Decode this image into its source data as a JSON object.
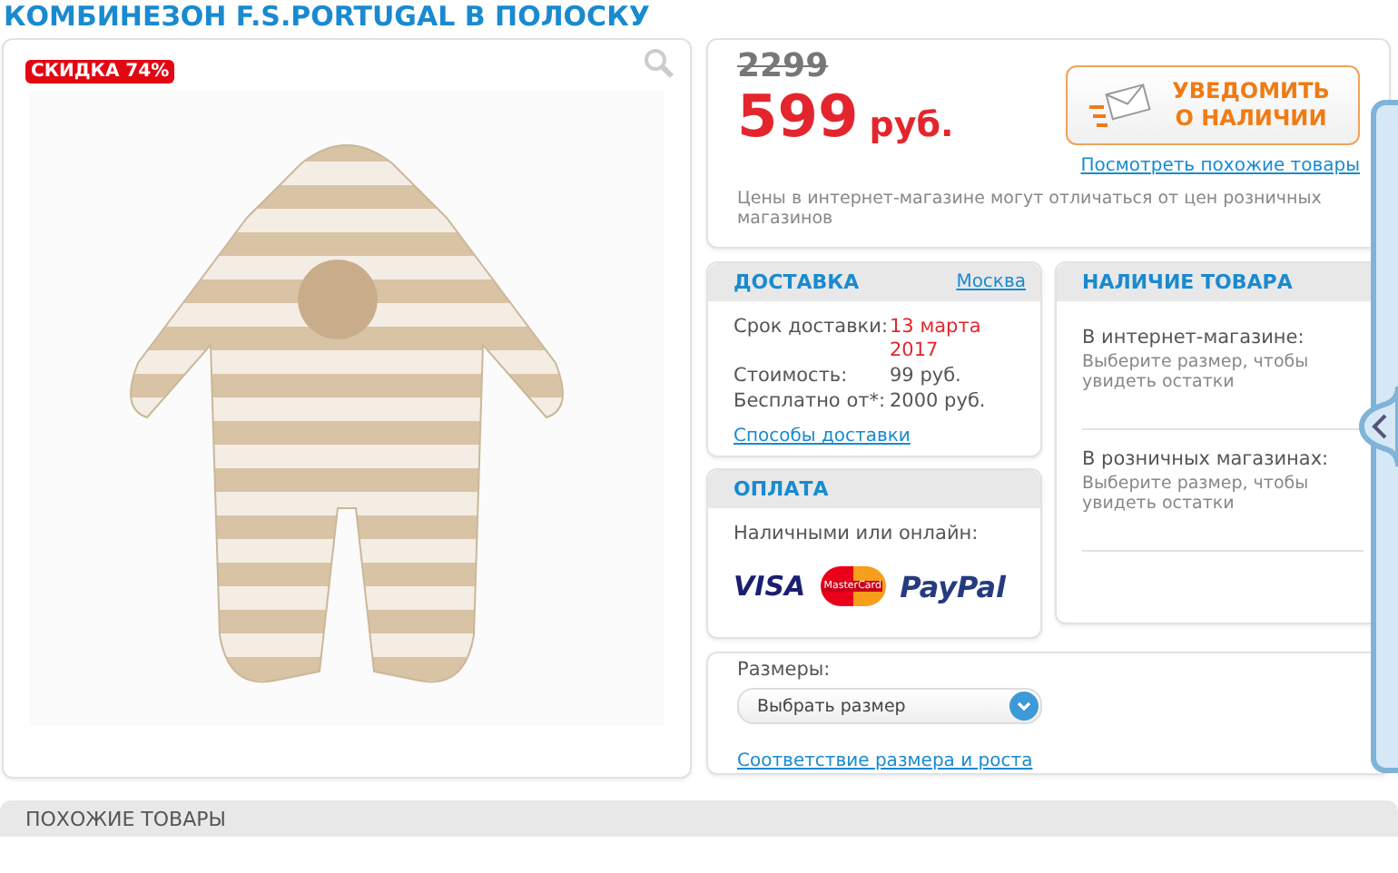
{
  "title": "КОМБИНЕЗОН F.S.PORTUGAL В ПОЛОСКУ",
  "product": {
    "discount_badge": "СКИДКА 74%"
  },
  "price": {
    "old": "2299",
    "current": "599",
    "currency": "руб.",
    "notify_button": "УВЕДОМИТЬ О НАЛИЧИИ",
    "similar_link": "Посмотреть похожие товары",
    "note": "Цены в интернет-магазине могут отличаться от цен розничных магазинов"
  },
  "delivery": {
    "heading": "ДОСТАВКА",
    "city_link": "Москва",
    "rows": [
      {
        "label": "Срок доставки:",
        "value": "13 марта 2017",
        "highlight": true
      },
      {
        "label": "Стоимость:",
        "value": "99 руб.",
        "highlight": false
      },
      {
        "label": "Бесплатно от*:",
        "value": "2000 руб.",
        "highlight": false
      }
    ],
    "methods_link": "Способы доставки"
  },
  "payment": {
    "heading": "ОПЛАТА",
    "label": "Наличными или онлайн:",
    "methods": [
      {
        "kind": "visa",
        "text": "VISA"
      },
      {
        "kind": "mastercard",
        "text": "MasterCard"
      },
      {
        "kind": "paypal",
        "text": "PayPal"
      }
    ]
  },
  "availability": {
    "heading": "НАЛИЧИЕ ТОВАРА",
    "sections": [
      {
        "title": "В интернет-магазине:",
        "hint": "Выберите размер, чтобы увидеть остатки"
      },
      {
        "title": "В розничных магазинах:",
        "hint": "Выберите размер, чтобы увидеть остатки"
      }
    ]
  },
  "sizes": {
    "label": "Размеры:",
    "select": {
      "value": "Выбрать размер"
    },
    "chart_link": "Соответствие размера и роста"
  },
  "similar": {
    "heading": "ПОХОЖИЕ ТОВАРЫ"
  }
}
